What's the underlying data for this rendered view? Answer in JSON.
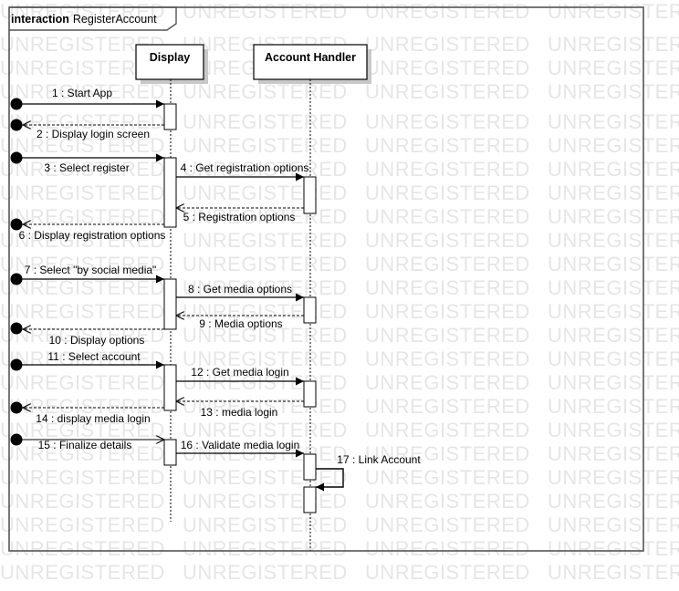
{
  "frame": {
    "keyword": "interaction",
    "name": "RegisterAccount"
  },
  "watermark": "UNREGISTERED",
  "lifelines": [
    {
      "id": "display",
      "label": "Display"
    },
    {
      "id": "handler",
      "label": "Account Handler"
    }
  ],
  "messages": [
    {
      "n": 1,
      "label": "1 : Start App"
    },
    {
      "n": 2,
      "label": "2 : Display login screen"
    },
    {
      "n": 3,
      "label": "3 : Select register"
    },
    {
      "n": 4,
      "label": "4 : Get registration options"
    },
    {
      "n": 5,
      "label": "5 : Registration options"
    },
    {
      "n": 6,
      "label": "6 : Display registration options"
    },
    {
      "n": 7,
      "label": "7 : Select \"by social media\""
    },
    {
      "n": 8,
      "label": "8 : Get media options"
    },
    {
      "n": 9,
      "label": "9 : Media options"
    },
    {
      "n": 10,
      "label": "10 : Display options"
    },
    {
      "n": 11,
      "label": "11 : Select account"
    },
    {
      "n": 12,
      "label": "12 : Get media login"
    },
    {
      "n": 13,
      "label": "13 : media login"
    },
    {
      "n": 14,
      "label": "14 : display media login"
    },
    {
      "n": 15,
      "label": "15 : Finalize details"
    },
    {
      "n": 16,
      "label": "16 : Validate media login"
    },
    {
      "n": 17,
      "label": "17 : Link Account"
    }
  ],
  "colors": {
    "line": "#000000",
    "shadow": "#c8c8c8",
    "frame": "#555555",
    "watermark": "#e6e6e6"
  }
}
